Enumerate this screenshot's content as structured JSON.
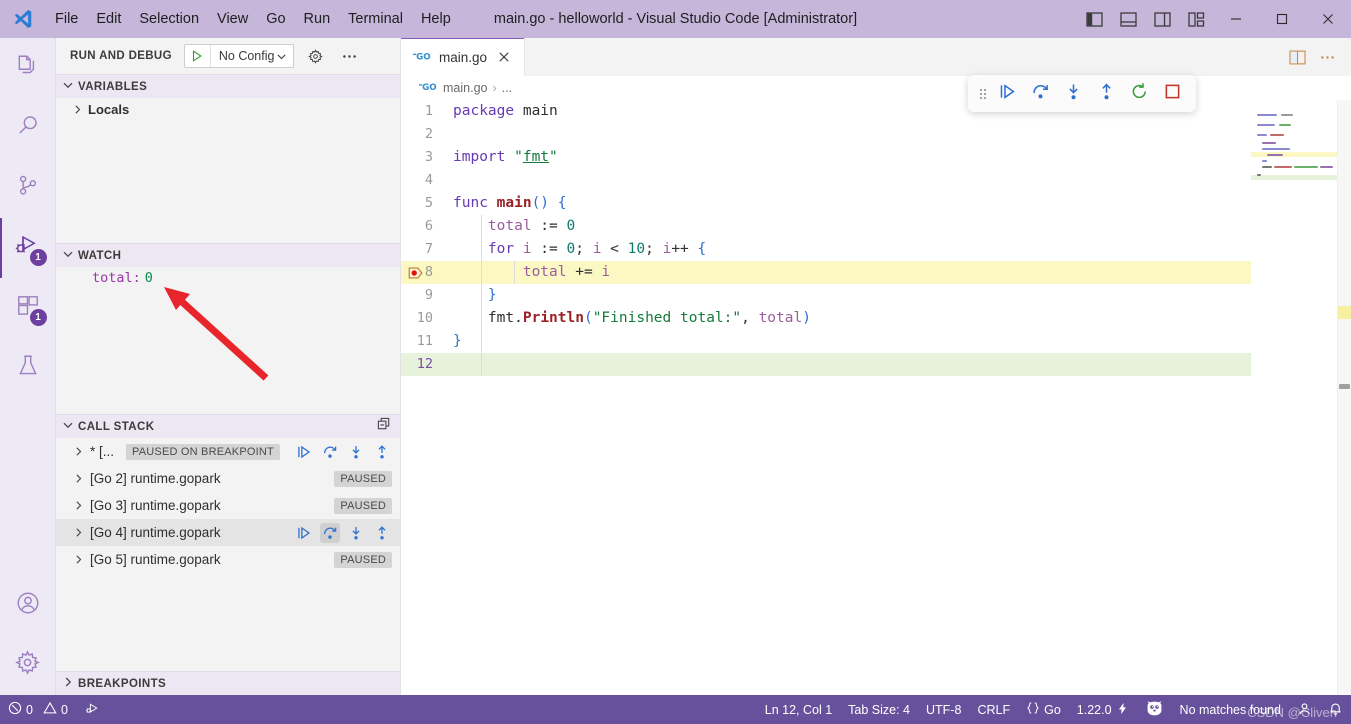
{
  "titlebar": {
    "logo_icon": "vscode-logo-icon",
    "menus": [
      "File",
      "Edit",
      "Selection",
      "View",
      "Go",
      "Run",
      "Terminal",
      "Help"
    ],
    "title": "main.go - helloworld - Visual Studio Code [Administrator]",
    "layout_buttons": [
      {
        "name": "toggle-primary-sidebar-icon",
        "label": ""
      },
      {
        "name": "toggle-panel-icon",
        "label": ""
      },
      {
        "name": "toggle-secondary-sidebar-icon",
        "label": ""
      },
      {
        "name": "customize-layout-icon",
        "label": ""
      }
    ],
    "window_buttons": [
      {
        "name": "minimize-button",
        "glyph": "—"
      },
      {
        "name": "maximize-button",
        "glyph": "□"
      },
      {
        "name": "close-button",
        "glyph": "✕"
      }
    ]
  },
  "activitybar": {
    "items": [
      {
        "name": "explorer",
        "icon": "files-icon",
        "badge": ""
      },
      {
        "name": "search",
        "icon": "search-icon",
        "badge": ""
      },
      {
        "name": "source-control",
        "icon": "source-control-icon",
        "badge": ""
      },
      {
        "name": "run-and-debug",
        "icon": "run-debug-icon",
        "badge": "1",
        "active": true
      },
      {
        "name": "extensions",
        "icon": "extensions-icon",
        "badge": "1"
      },
      {
        "name": "testing",
        "icon": "beaker-icon",
        "badge": ""
      }
    ],
    "bottom_items": [
      {
        "name": "accounts",
        "icon": "account-icon"
      },
      {
        "name": "manage-settings",
        "icon": "gear-icon"
      }
    ]
  },
  "sidebar": {
    "header": {
      "title": "RUN AND DEBUG",
      "config_label": "No Config",
      "play_icon": "start-debug-icon",
      "chevron_icon": "chevron-down-icon",
      "gear_icon": "gear-icon",
      "more_icon": "ellipsis-icon"
    },
    "variables": {
      "title": "VARIABLES",
      "chevron": "chevron-down-icon",
      "rows": [
        {
          "label": "Locals",
          "twisty": "chevron-right-icon"
        }
      ]
    },
    "watch": {
      "title": "WATCH",
      "chevron": "chevron-down-icon",
      "expressions": [
        {
          "name": "total:",
          "value": "0"
        }
      ]
    },
    "callstack": {
      "title": "CALL STACK",
      "chevron": "chevron-down-icon",
      "collapse_icon": "collapse-all-icon",
      "rows": [
        {
          "label": "* [...",
          "state": "PAUSED ON BREAKPOINT",
          "has_actions": true,
          "selected": false,
          "highlight_action": ""
        },
        {
          "label": "[Go 2] runtime.gopark",
          "state": "PAUSED",
          "has_actions": false,
          "selected": false,
          "highlight_action": ""
        },
        {
          "label": "[Go 3] runtime.gopark",
          "state": "PAUSED",
          "has_actions": false,
          "selected": false,
          "highlight_action": ""
        },
        {
          "label": "[Go 4] runtime.gopark",
          "state": "",
          "has_actions": true,
          "selected": true,
          "highlight_action": "step-over"
        },
        {
          "label": "[Go 5] runtime.gopark",
          "state": "PAUSED",
          "has_actions": false,
          "selected": false,
          "highlight_action": ""
        }
      ],
      "row_action_icons": [
        "continue-icon",
        "step-over-icon",
        "step-into-icon",
        "step-out-icon"
      ]
    },
    "breakpoints": {
      "title": "BREAKPOINTS",
      "chevron": "chevron-right-icon"
    }
  },
  "editor": {
    "tab": {
      "label": "main.go",
      "icon": "go-file-icon",
      "close_icon": "close-icon"
    },
    "tab_actions": [
      {
        "name": "split-editor-right-button",
        "icon": "split-editor-icon"
      },
      {
        "name": "more-editor-actions-button",
        "icon": "ellipsis-icon"
      }
    ],
    "breadcrumbs": [
      {
        "label": "main.go",
        "icon": "go-file-icon"
      },
      {
        "label": "...",
        "icon": ""
      }
    ],
    "breadcrumb_separator": "›",
    "breakpoint_line": 8,
    "lines": [
      {
        "n": 1,
        "tokens": [
          {
            "t": "package ",
            "c": "k-kw"
          },
          {
            "t": "main",
            "c": "k-pkg"
          }
        ],
        "hl": "",
        "indent": 0
      },
      {
        "n": 2,
        "tokens": [],
        "hl": "",
        "indent": 0
      },
      {
        "n": 3,
        "tokens": [
          {
            "t": "import ",
            "c": "k-kw"
          },
          {
            "t": "\"",
            "c": "k-str"
          },
          {
            "t": "fmt",
            "c": "k-imp"
          },
          {
            "t": "\"",
            "c": "k-str"
          }
        ],
        "hl": "",
        "indent": 0
      },
      {
        "n": 4,
        "tokens": [],
        "hl": "",
        "indent": 0
      },
      {
        "n": 5,
        "tokens": [
          {
            "t": "func ",
            "c": "k-kw"
          },
          {
            "t": "main",
            "c": "k-fn"
          },
          {
            "t": "()",
            "c": "k-br"
          },
          {
            "t": " ",
            "c": "k-op"
          },
          {
            "t": "{",
            "c": "k-br"
          }
        ],
        "hl": "",
        "indent": 0
      },
      {
        "n": 6,
        "tokens": [
          {
            "t": "    ",
            "c": "k-op"
          },
          {
            "t": "total",
            "c": "k-var"
          },
          {
            "t": " := ",
            "c": "k-op"
          },
          {
            "t": "0",
            "c": "k-num"
          }
        ],
        "hl": "",
        "indent": 1
      },
      {
        "n": 7,
        "tokens": [
          {
            "t": "    ",
            "c": "k-op"
          },
          {
            "t": "for ",
            "c": "k-kw"
          },
          {
            "t": "i",
            "c": "k-var"
          },
          {
            "t": " := ",
            "c": "k-op"
          },
          {
            "t": "0",
            "c": "k-num"
          },
          {
            "t": "; ",
            "c": "k-op"
          },
          {
            "t": "i",
            "c": "k-var"
          },
          {
            "t": " < ",
            "c": "k-op"
          },
          {
            "t": "10",
            "c": "k-num"
          },
          {
            "t": "; ",
            "c": "k-op"
          },
          {
            "t": "i",
            "c": "k-var"
          },
          {
            "t": "++ ",
            "c": "k-op"
          },
          {
            "t": "{",
            "c": "k-br"
          }
        ],
        "hl": "",
        "indent": 1
      },
      {
        "n": 8,
        "tokens": [
          {
            "t": "        ",
            "c": "k-op"
          },
          {
            "t": "total",
            "c": "k-var"
          },
          {
            "t": " += ",
            "c": "k-op"
          },
          {
            "t": "i",
            "c": "k-var"
          }
        ],
        "hl": "debug",
        "indent": 2
      },
      {
        "n": 9,
        "tokens": [
          {
            "t": "    ",
            "c": "k-op"
          },
          {
            "t": "}",
            "c": "k-br"
          }
        ],
        "hl": "",
        "indent": 1
      },
      {
        "n": 10,
        "tokens": [
          {
            "t": "    ",
            "c": "k-op"
          },
          {
            "t": "fmt",
            "c": "k-id"
          },
          {
            "t": ".",
            "c": "k-op"
          },
          {
            "t": "Println",
            "c": "k-fn"
          },
          {
            "t": "(",
            "c": "k-br"
          },
          {
            "t": "\"Finished total:\"",
            "c": "k-str"
          },
          {
            "t": ", ",
            "c": "k-op"
          },
          {
            "t": "total",
            "c": "k-var"
          },
          {
            "t": ")",
            "c": "k-br"
          }
        ],
        "hl": "",
        "indent": 1
      },
      {
        "n": 11,
        "tokens": [
          {
            "t": "}",
            "c": "k-br"
          }
        ],
        "hl": "",
        "indent": 0
      },
      {
        "n": 12,
        "tokens": [],
        "hl": "green",
        "indent": 0,
        "current": true
      }
    ]
  },
  "debug_toolbar": {
    "grip_icon": "drag-handle-icon",
    "buttons": [
      {
        "name": "continue-button",
        "icon": "continue-icon",
        "color": "#2f6fd0"
      },
      {
        "name": "step-over-button",
        "icon": "step-over-icon",
        "color": "#2f6fd0"
      },
      {
        "name": "step-into-button",
        "icon": "step-into-icon",
        "color": "#2f6fd0"
      },
      {
        "name": "step-out-button",
        "icon": "step-out-icon",
        "color": "#2f6fd0"
      },
      {
        "name": "restart-button",
        "icon": "restart-icon",
        "color": "#3a9c3a"
      },
      {
        "name": "stop-button",
        "icon": "stop-icon",
        "color": "#c0392b"
      }
    ]
  },
  "statusbar": {
    "errors": "0",
    "warnings": "0",
    "error_icon": "error-circle-icon",
    "warning_icon": "warning-triangle-icon",
    "debug_icon": "run-debug-icon",
    "right_items": [
      {
        "name": "editor-position",
        "label": "Ln 12, Col 1"
      },
      {
        "name": "editor-indentation",
        "label": "Tab Size: 4"
      },
      {
        "name": "editor-encoding",
        "label": "UTF-8"
      },
      {
        "name": "editor-eol",
        "label": "CRLF"
      },
      {
        "name": "editor-language",
        "label": "Go",
        "icon": "braces-icon"
      },
      {
        "name": "go-version",
        "label": "1.22.0",
        "icon": "zap-icon"
      },
      {
        "name": "go-mascot",
        "label": "",
        "icon": "gopher-icon"
      },
      {
        "name": "search-result",
        "label": "No matches found"
      },
      {
        "name": "remote-account",
        "label": "",
        "icon": "account-icon"
      },
      {
        "name": "notifications",
        "label": "",
        "icon": "bell-icon"
      }
    ]
  },
  "watermark": {
    "text": "CSDN @Cliven"
  },
  "colors": {
    "titlebar_bg": "#c6b6da",
    "statusbar_bg": "#68519c",
    "activitybar_bg": "#eeeaf5",
    "sidebar_bg": "#f3f3f3",
    "section_head_bg": "#ece7f2",
    "debug_line_hl": "#fbf8c4",
    "green_line_hl": "#e6f2da",
    "accent": "#6c3fa0",
    "annotation_red": "#e8252a"
  }
}
